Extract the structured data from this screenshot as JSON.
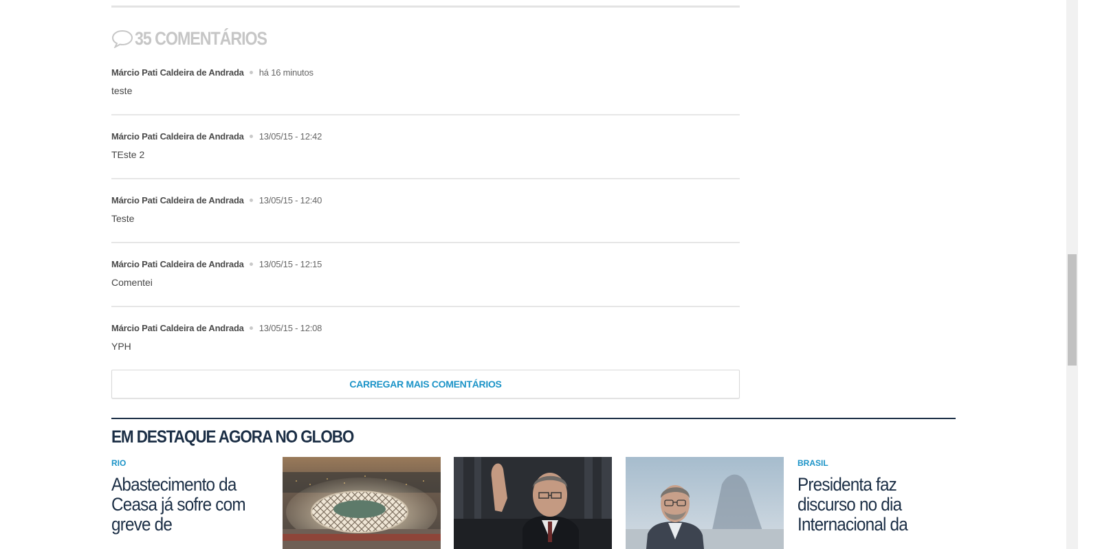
{
  "comments_section": {
    "count_label": "35 COMENTÁRIOS",
    "items": [
      {
        "author": "Márcio Pati Caldeira de Andrada",
        "time": "há 16 minutos",
        "text": "teste"
      },
      {
        "author": "Márcio Pati Caldeira de Andrada",
        "time": "13/05/15 - 12:42",
        "text": "TEste 2"
      },
      {
        "author": "Márcio Pati Caldeira de Andrada",
        "time": "13/05/15 - 12:40",
        "text": "Teste"
      },
      {
        "author": "Márcio Pati Caldeira de Andrada",
        "time": "13/05/15 - 12:15",
        "text": "Comentei"
      },
      {
        "author": "Márcio Pati Caldeira de Andrada",
        "time": "13/05/15 - 12:08",
        "text": "YPH"
      }
    ],
    "load_more_label": "CARREGAR MAIS COMENTÁRIOS"
  },
  "highlights": {
    "title": "EM DESTAQUE AGORA NO GLOBO",
    "cards": [
      {
        "tag": "RIO",
        "headline_lines": [
          "Abastecimento da",
          "Ceasa já sofre com",
          "greve de"
        ]
      },
      {
        "image": "stadium-photo"
      },
      {
        "image": "senator-photo"
      },
      {
        "image": "man-glasses-photo"
      },
      {
        "tag": "BRASIL",
        "headline_lines": [
          "Presidenta faz",
          "discurso no dia",
          "Internacional da"
        ]
      }
    ]
  },
  "colors": {
    "accent_blue": "#1b93c7",
    "navy": "#1b2e45",
    "muted_gray": "#c6c6c6"
  }
}
